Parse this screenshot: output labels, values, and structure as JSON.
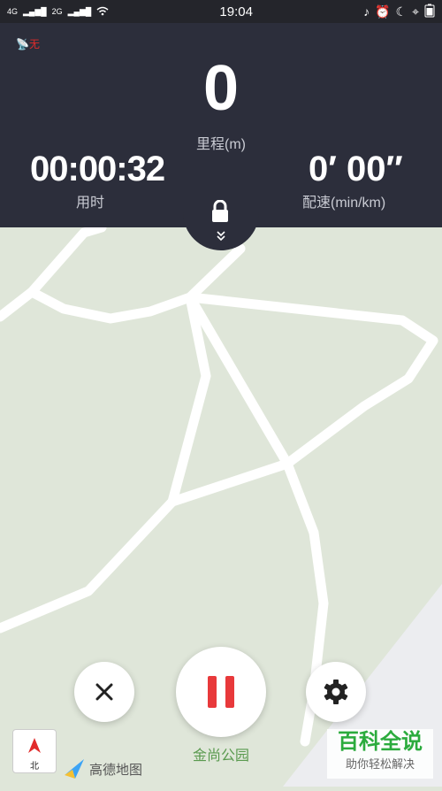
{
  "status_bar": {
    "network1": "4G",
    "network2": "2G",
    "time": "19:04"
  },
  "gps": {
    "label": "无"
  },
  "distance": {
    "value": "0",
    "label": "里程(m)"
  },
  "duration": {
    "value": "00:00:32",
    "label": "用时"
  },
  "pace": {
    "value": "0′ 00″",
    "label": "配速(min/km)"
  },
  "map": {
    "park_label": "金尚公园"
  },
  "compass": {
    "label": "北"
  },
  "map_provider": {
    "label": "高德地图"
  },
  "watermark": {
    "main": "百科全说",
    "sub": "助你轻松解决"
  },
  "colors": {
    "panel": "#2c2e3b",
    "pause": "#e8393b",
    "map": "#dfe6d9",
    "watermark": "#2bab3d"
  }
}
